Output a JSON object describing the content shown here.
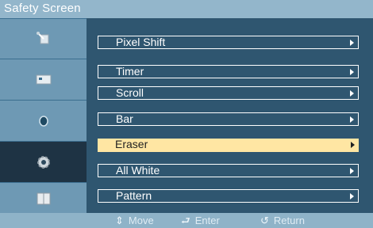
{
  "header": {
    "title": "Safety Screen"
  },
  "sidebar": {
    "items": [
      {
        "icon": "satellite-dish-icon"
      },
      {
        "icon": "monitor-screen-icon"
      },
      {
        "icon": "sound-icon"
      },
      {
        "icon": "gear-icon",
        "active": true
      },
      {
        "icon": "book-icon"
      }
    ]
  },
  "menu": {
    "items": [
      {
        "label": "Pixel Shift"
      },
      {
        "label": "Timer"
      },
      {
        "label": "Scroll"
      },
      {
        "label": "Bar"
      },
      {
        "label": "Eraser",
        "selected": true
      },
      {
        "label": "All White"
      },
      {
        "label": "Pattern"
      }
    ]
  },
  "footer": {
    "move_icon": "⇕",
    "move_label": "Move",
    "enter_icon": "⮐",
    "enter_label": "Enter",
    "return_icon": "↺",
    "return_label": "Return"
  },
  "colors": {
    "selected_background": "#ffe6a3",
    "content_background": "#2f5670",
    "frame": "#5d8fb0"
  }
}
